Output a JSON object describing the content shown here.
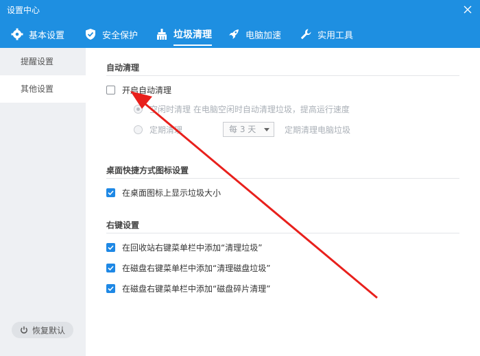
{
  "window": {
    "title": "设置中心"
  },
  "tabs": [
    {
      "label": "基本设置",
      "icon": "gear-icon",
      "active": false
    },
    {
      "label": "安全保护",
      "icon": "shield-icon",
      "active": false
    },
    {
      "label": "垃圾清理",
      "icon": "broom-icon",
      "active": true
    },
    {
      "label": "电脑加速",
      "icon": "rocket-icon",
      "active": false
    },
    {
      "label": "实用工具",
      "icon": "wrench-icon",
      "active": false
    }
  ],
  "sidebar": {
    "items": [
      {
        "label": "提醒设置",
        "active": false
      },
      {
        "label": "其他设置",
        "active": true
      }
    ],
    "restore_label": "恢复默认"
  },
  "auto_clean": {
    "title": "自动清理",
    "enable_label": "开启自动清理",
    "enable_checked": false,
    "idle_label": "空闲时清理  在电脑空闲时自动清理垃圾，提高运行速度",
    "scheduled_label": "定期清理",
    "interval_value": "每 3 天",
    "scheduled_desc": "定期清理电脑垃圾"
  },
  "desktop": {
    "title": "桌面快捷方式图标设置",
    "show_size_label": "在桌面图标上显示垃圾大小",
    "show_size_checked": true
  },
  "context_menu": {
    "title": "右键设置",
    "items": [
      {
        "label": "在回收站右键菜单栏中添加“清理垃圾”",
        "checked": true
      },
      {
        "label": "在磁盘右键菜单栏中添加“清理磁盘垃圾”",
        "checked": true
      },
      {
        "label": "在磁盘右键菜单栏中添加“磁盘碎片清理”",
        "checked": true
      }
    ]
  },
  "colors": {
    "accent": "#1e8fe1",
    "checkbox": "#1e88e5",
    "annotation_arrow": "#e8201c"
  }
}
